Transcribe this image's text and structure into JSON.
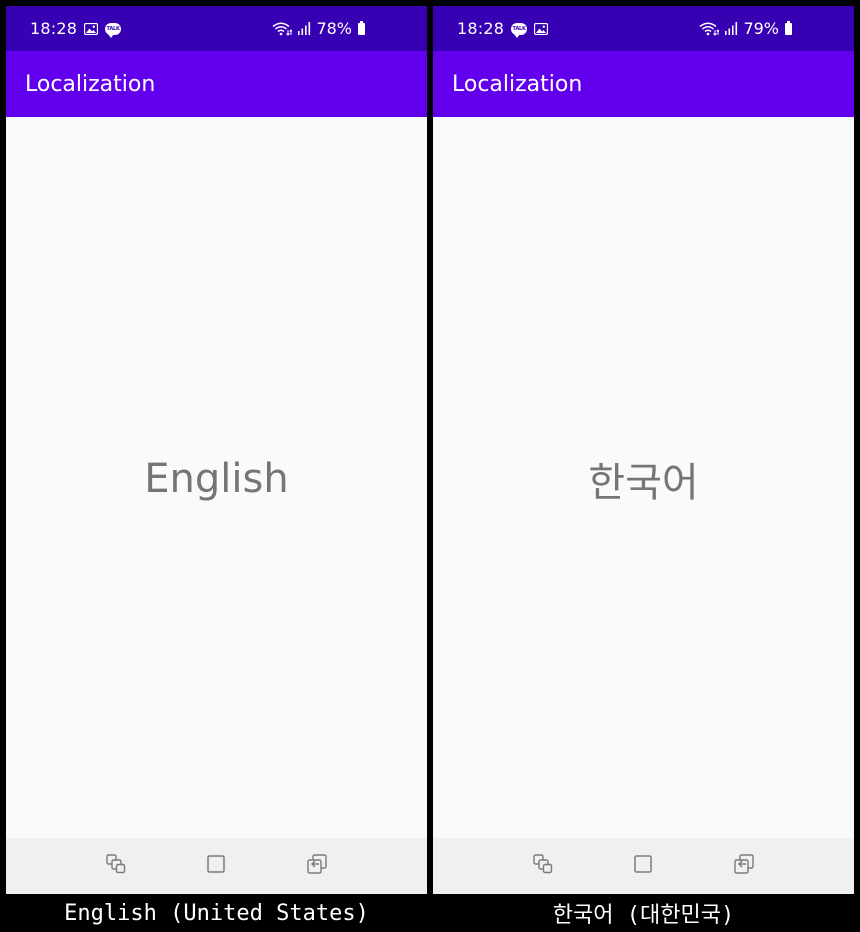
{
  "colors": {
    "status_bar": "#3700b3",
    "app_bar": "#6200ee",
    "content_bg": "#fafafa",
    "nav_bar": "#f0f0f0",
    "lang_text": "#757575",
    "frame": "#000000"
  },
  "screens": [
    {
      "status": {
        "time": "18:28",
        "left_icons": [
          "image-icon",
          "talk-icon"
        ],
        "talk_label": "TALK",
        "battery": "78%",
        "right_icons": [
          "wifi-icon",
          "signal-icon",
          "battery-icon"
        ]
      },
      "app_bar": {
        "title": "Localization"
      },
      "content": {
        "text": "English"
      },
      "nav": [
        "recent-apps-icon",
        "home-icon",
        "back-icon"
      ],
      "caption": "English (United States)"
    },
    {
      "status": {
        "time": "18:28",
        "left_icons": [
          "talk-icon",
          "image-icon"
        ],
        "talk_label": "TALK",
        "battery": "79%",
        "right_icons": [
          "wifi-icon",
          "signal-icon",
          "battery-icon"
        ]
      },
      "app_bar": {
        "title": "Localization"
      },
      "content": {
        "text": "한국어"
      },
      "nav": [
        "recent-apps-icon",
        "home-icon",
        "back-icon"
      ],
      "caption": "한국어 (대한민국)"
    }
  ]
}
